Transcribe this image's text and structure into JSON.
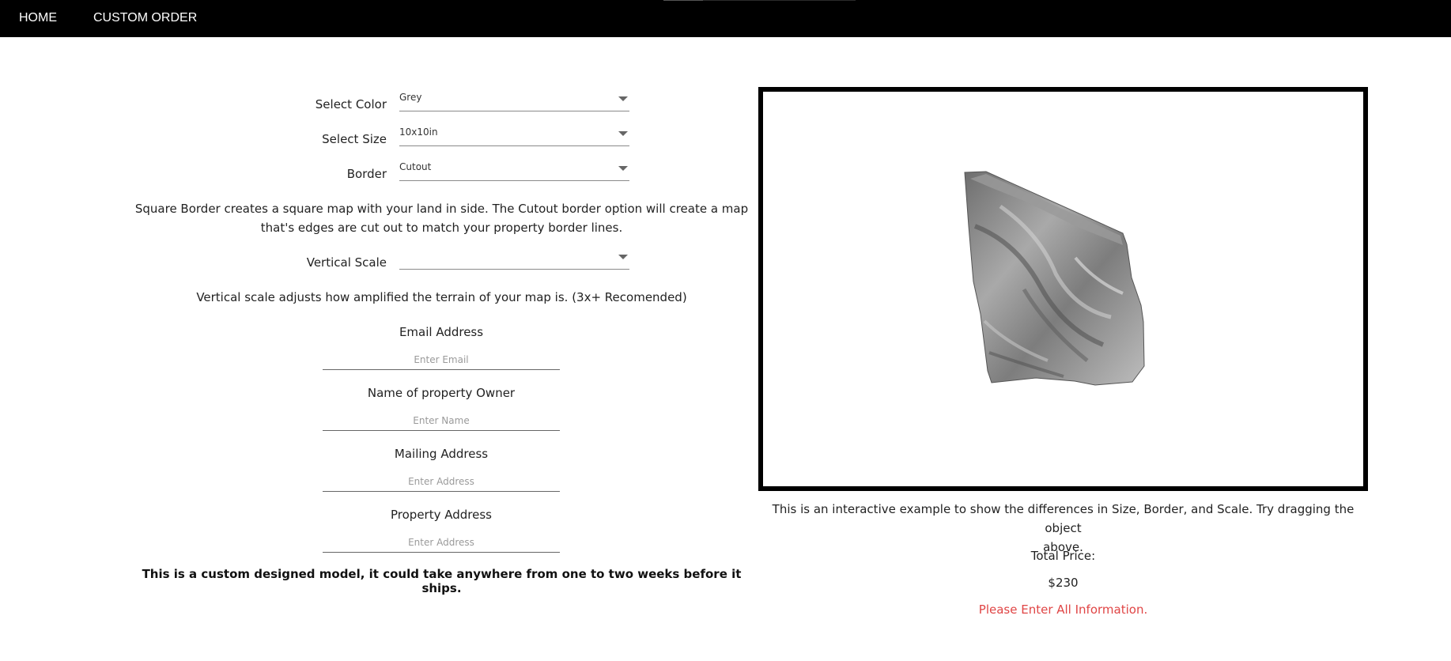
{
  "nav": {
    "home": "HOME",
    "custom_order": "CUSTOM ORDER"
  },
  "form": {
    "color": {
      "label": "Select Color",
      "value": "Grey"
    },
    "size": {
      "label": "Select Size",
      "value": "10x10in"
    },
    "border": {
      "label": "Border",
      "value": "Cutout"
    },
    "border_help_line1": "Square Border creates a square map with your land in side. The Cutout border option will create a map",
    "border_help_line2": "that's edges are cut out to match your property border lines.",
    "vertical_scale": {
      "label": "Vertical Scale",
      "value": ""
    },
    "vertical_help": "Vertical scale adjusts how amplified the terrain of your map is. (3x+ Recomended)",
    "email": {
      "label": "Email Address",
      "placeholder": "Enter Email"
    },
    "owner": {
      "label": "Name of property Owner",
      "placeholder": "Enter Name"
    },
    "mailing": {
      "label": "Mailing Address",
      "placeholder": "Enter Address"
    },
    "property": {
      "label": "Property Address",
      "placeholder": "Enter Address"
    },
    "notice": "This is a custom designed model, it could take anywhere from one to two weeks before it ships."
  },
  "preview": {
    "caption_line1": "This is an interactive example to show the differences in Size, Border, and Scale. Try dragging the object",
    "caption_line2": "above.",
    "model_color": "#8c8c8c"
  },
  "order": {
    "total_label": "Total Price:",
    "total_value": "$230",
    "error": "Please Enter All Information."
  },
  "colors": {
    "nav_bg": "#000000",
    "error": "#e04545",
    "frame": "#000000"
  }
}
